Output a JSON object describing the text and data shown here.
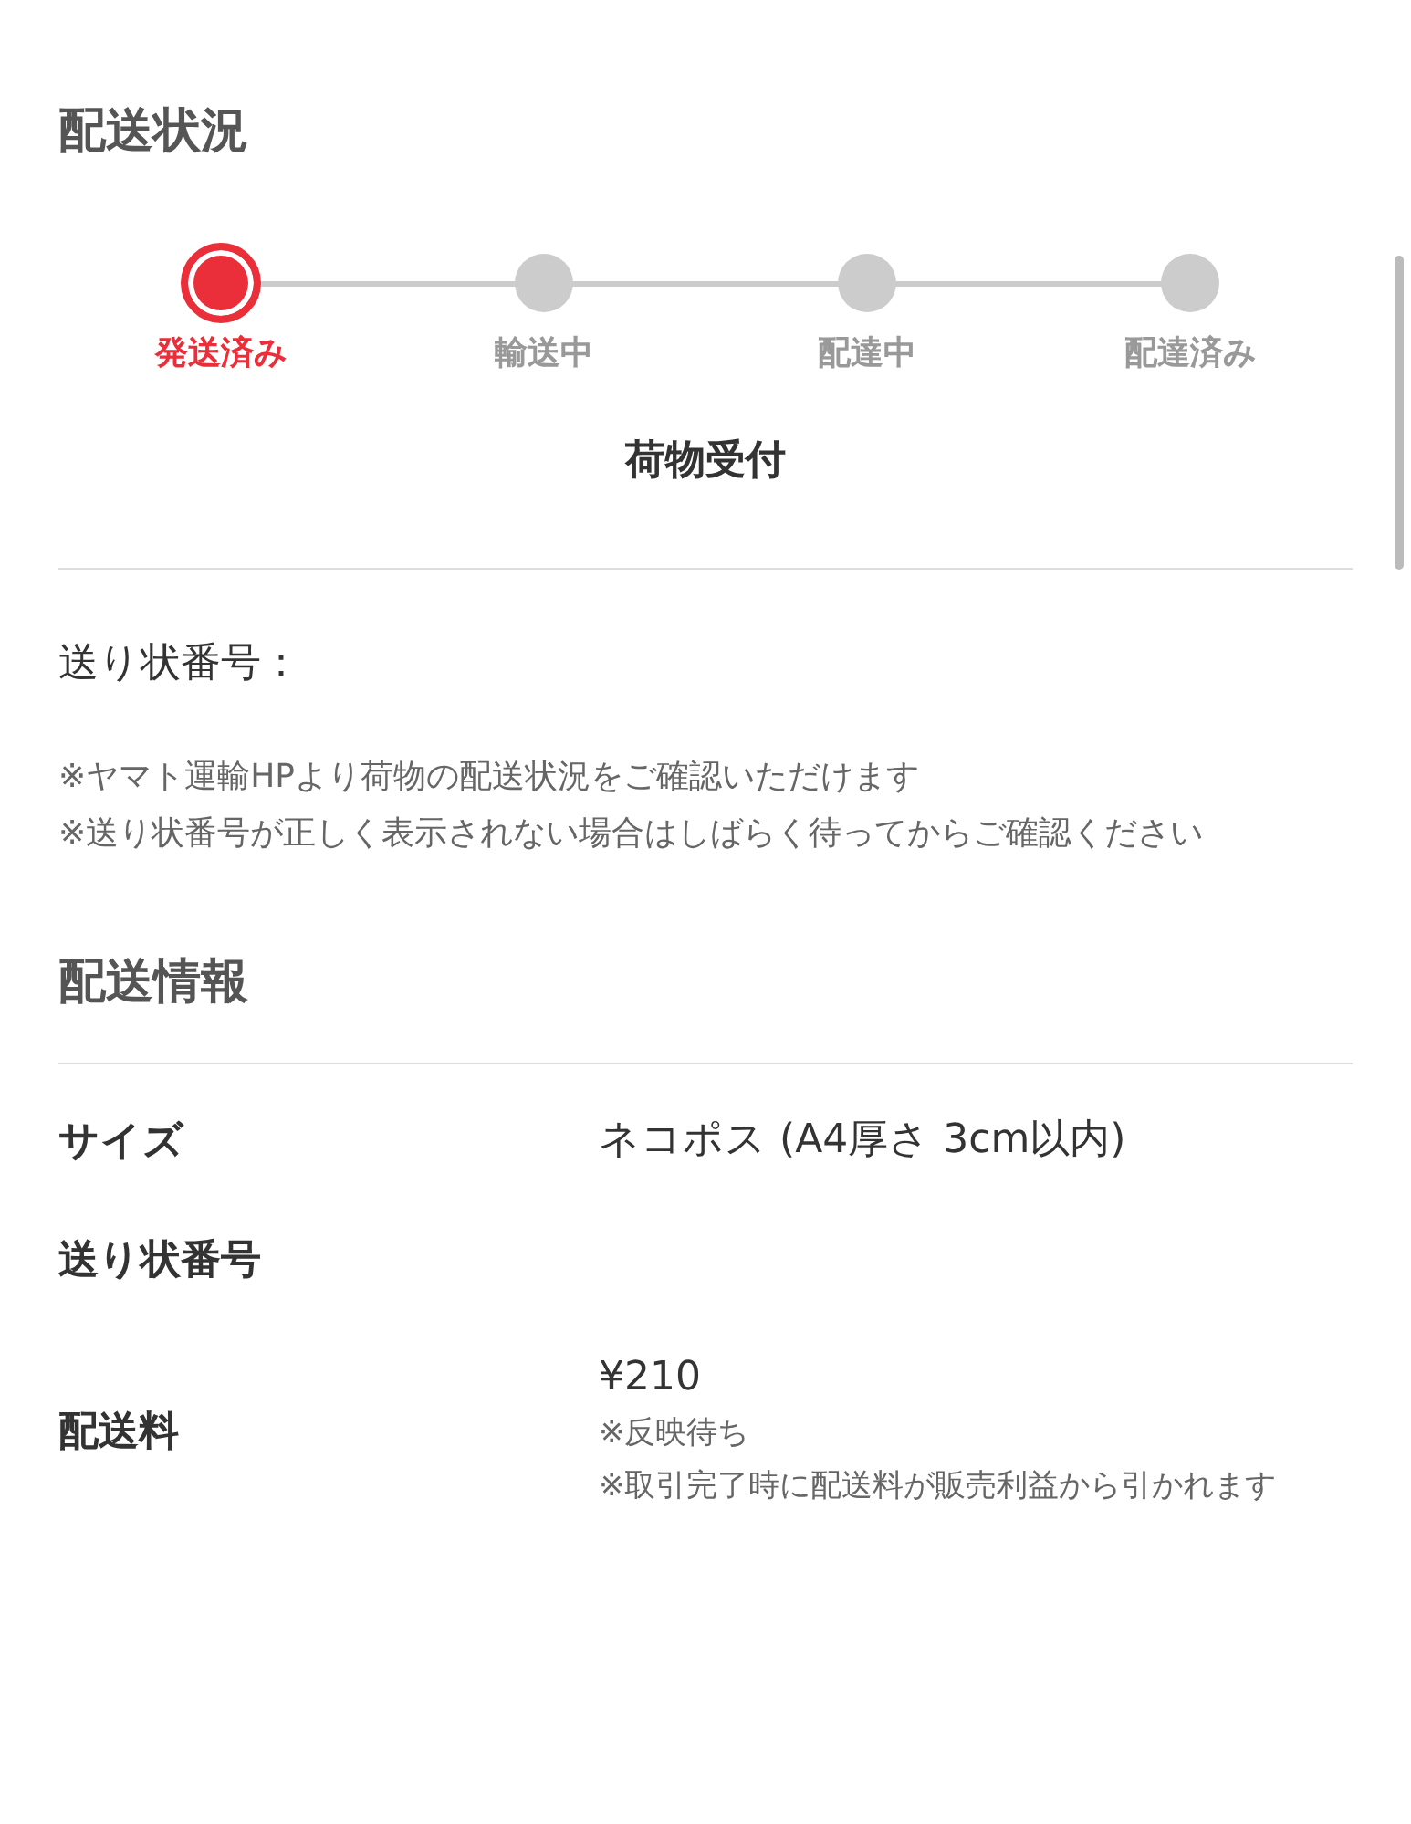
{
  "shipping_status": {
    "title": "配送状況",
    "steps": [
      {
        "label": "発送済み",
        "selected": true
      },
      {
        "label": "輸送中",
        "selected": false
      },
      {
        "label": "配達中",
        "selected": false
      },
      {
        "label": "配達済み",
        "selected": false
      }
    ],
    "current_status": "荷物受付"
  },
  "tracking": {
    "label": "送り状番号：",
    "notes": [
      "※ヤマト運輸HPより荷物の配送状況をご確認いただけます",
      "※送り状番号が正しく表示されない場合はしばらく待ってからご確認ください"
    ]
  },
  "shipping_info": {
    "title": "配送情報",
    "rows": [
      {
        "label": "サイズ",
        "value": "ネコポス (A4厚さ 3cm以内)",
        "notes": []
      },
      {
        "label": "送り状番号",
        "value": "",
        "notes": []
      },
      {
        "label": "配送料",
        "value": "¥210",
        "notes": [
          "※反映待ち",
          "※取引完了時に配送料が販売利益から引かれます"
        ]
      }
    ]
  }
}
